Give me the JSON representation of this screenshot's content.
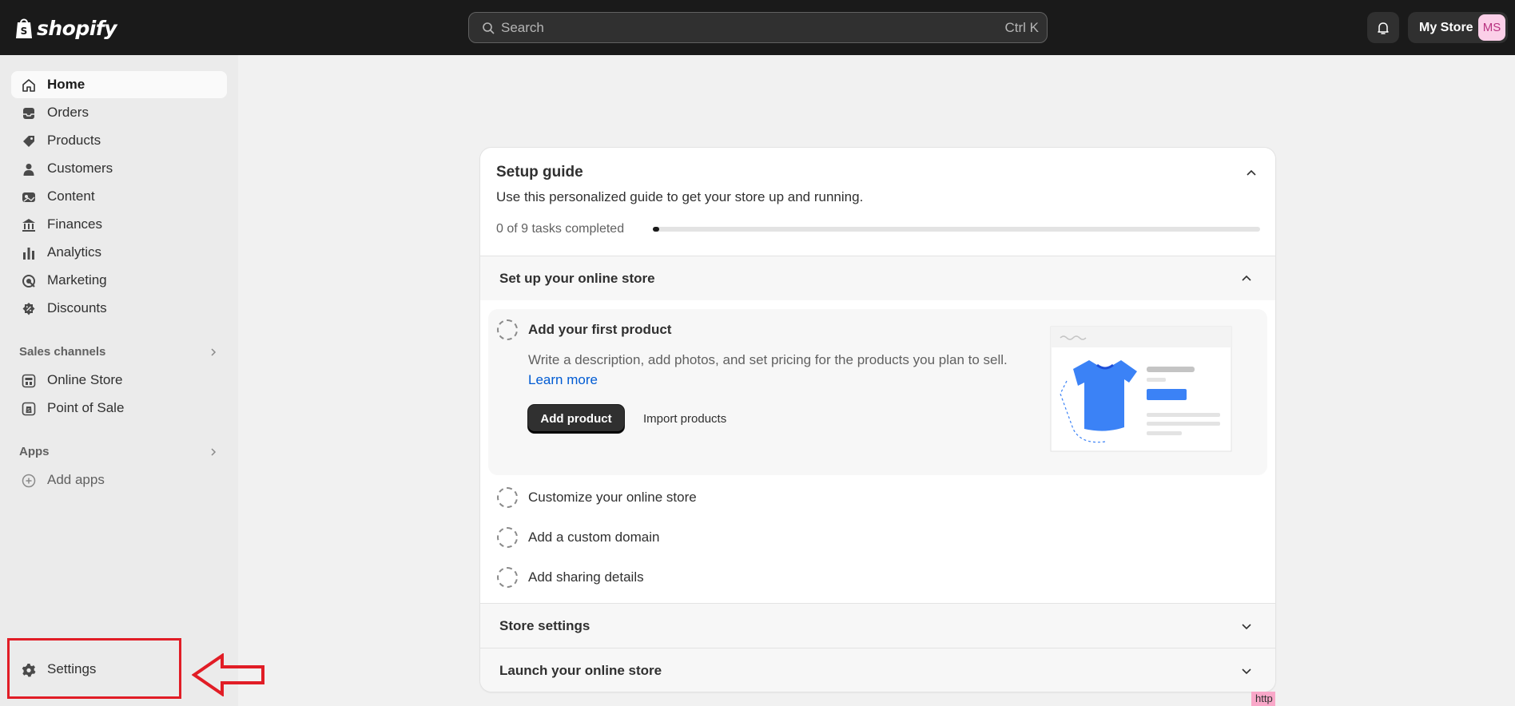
{
  "topbar": {
    "logo_text": "shopify",
    "search_placeholder": "Search",
    "search_shortcut": "Ctrl K",
    "store_name": "My Store",
    "avatar_initials": "MS"
  },
  "sidebar": {
    "items": [
      {
        "label": "Home",
        "icon": "home-icon"
      },
      {
        "label": "Orders",
        "icon": "inbox-icon"
      },
      {
        "label": "Products",
        "icon": "tag-icon"
      },
      {
        "label": "Customers",
        "icon": "person-icon"
      },
      {
        "label": "Content",
        "icon": "image-icon"
      },
      {
        "label": "Finances",
        "icon": "bank-icon"
      },
      {
        "label": "Analytics",
        "icon": "bar-chart-icon"
      },
      {
        "label": "Marketing",
        "icon": "target-icon"
      },
      {
        "label": "Discounts",
        "icon": "discount-icon"
      }
    ],
    "sales_channels_title": "Sales channels",
    "sales_channels": [
      {
        "label": "Online Store",
        "icon": "store-icon"
      },
      {
        "label": "Point of Sale",
        "icon": "pos-icon"
      }
    ],
    "apps_title": "Apps",
    "add_apps_label": "Add apps",
    "settings_label": "Settings"
  },
  "setup_guide": {
    "title": "Setup guide",
    "subtitle": "Use this personalized guide to get your store up and running.",
    "progress_text": "0 of 9 tasks completed",
    "progress_fraction": 0.0,
    "section_online_store": "Set up your online store",
    "expanded_task": {
      "title": "Add your first product",
      "description": "Write a description, add photos, and set pricing for the products you plan to sell.",
      "link": "Learn more",
      "primary_button": "Add product",
      "secondary_button": "Import products"
    },
    "tasks": [
      "Customize your online store",
      "Add a custom domain",
      "Add sharing details"
    ],
    "section_store_settings": "Store settings",
    "section_launch": "Launch your online store"
  },
  "corner_badge": "http",
  "colors": {
    "topbar": "#1a1a1a",
    "sidebar": "#ebebeb",
    "accent_link": "#005bd3",
    "annotation_red": "#e11d26"
  }
}
